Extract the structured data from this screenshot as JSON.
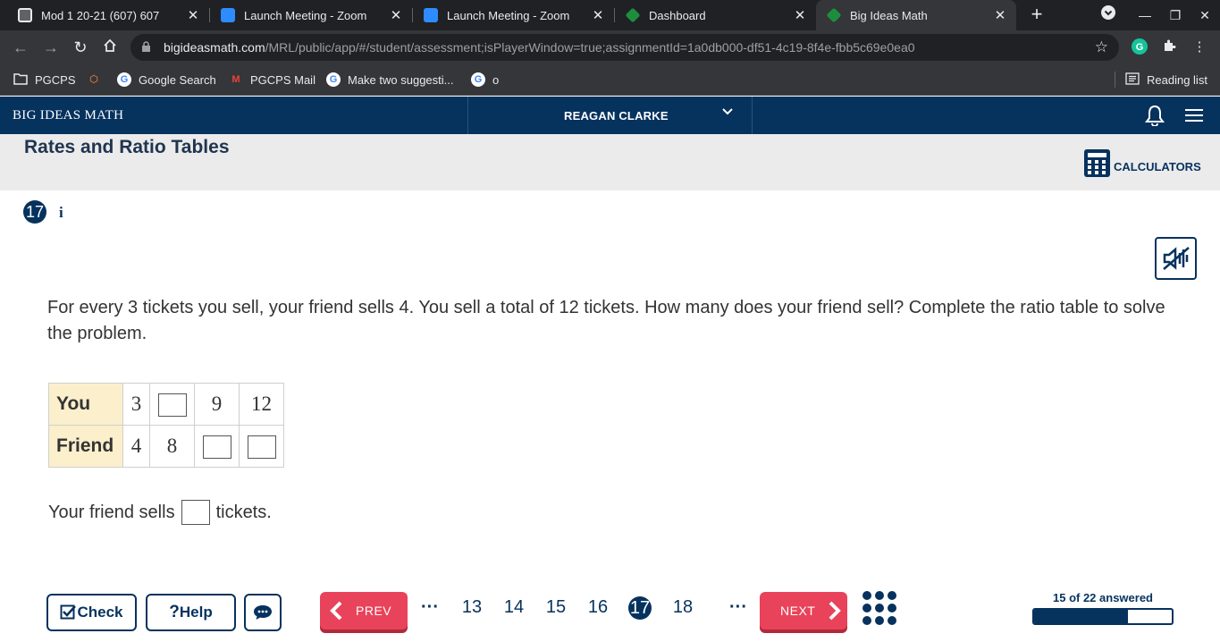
{
  "browser": {
    "tabs": [
      {
        "title": "Mod 1 20-21 (607) 607",
        "icon": "classroom-icon",
        "color": "#e8eaed"
      },
      {
        "title": "Launch Meeting - Zoom",
        "icon": "zoom-icon",
        "color": "#2d8cff"
      },
      {
        "title": "Launch Meeting - Zoom",
        "icon": "zoom-icon",
        "color": "#2d8cff"
      },
      {
        "title": "Dashboard",
        "icon": "dashboard-icon",
        "color": "#1e8e3e"
      },
      {
        "title": "Big Ideas Math",
        "icon": "bigideas-icon",
        "color": "#1e8e3e"
      }
    ],
    "url_host": "bigideasmath.com",
    "url_path": "/MRL/public/app/#/student/assessment;isPlayerWindow=true;assignmentId=1a0db000-df51-4c19-8f4e-fbb5c69e0ea0",
    "bookmarks": [
      "PGCPS",
      "Google Search",
      "PGCPS Mail",
      "Make two suggesti...",
      "o"
    ],
    "reading_list": "Reading list"
  },
  "header": {
    "brand": "BIG IDEAS MATH",
    "user": "REAGAN CLARKE"
  },
  "lesson": {
    "title": "Rates and Ratio Tables",
    "calculators_label": "CALCULATORS"
  },
  "question": {
    "number": "17",
    "info": "i",
    "prompt": "For every 3 tickets you sell, your friend sells 4.  You sell a total of 12 tickets.  How many does your friend sell? Complete the ratio table to solve the problem.",
    "table": {
      "row1_label": "You",
      "row1": [
        "3",
        "",
        "9",
        "12"
      ],
      "row2_label": "Friend",
      "row2": [
        "4",
        "8",
        "",
        ""
      ]
    },
    "sentence_before": "Your friend sells",
    "sentence_after": "tickets."
  },
  "toolbar": {
    "check": "Check",
    "help": "Help",
    "prev": "PREV",
    "next": "NEXT",
    "ellipsis": "···",
    "pages": [
      "13",
      "14",
      "15",
      "16",
      "17",
      "18"
    ],
    "current_page": "17",
    "progress_label": "15 of 22 answered",
    "answered": 15,
    "total": 22
  },
  "colors": {
    "brand_navy": "#06325e",
    "accent_red": "#e8435a",
    "table_header": "#fbefcc"
  }
}
